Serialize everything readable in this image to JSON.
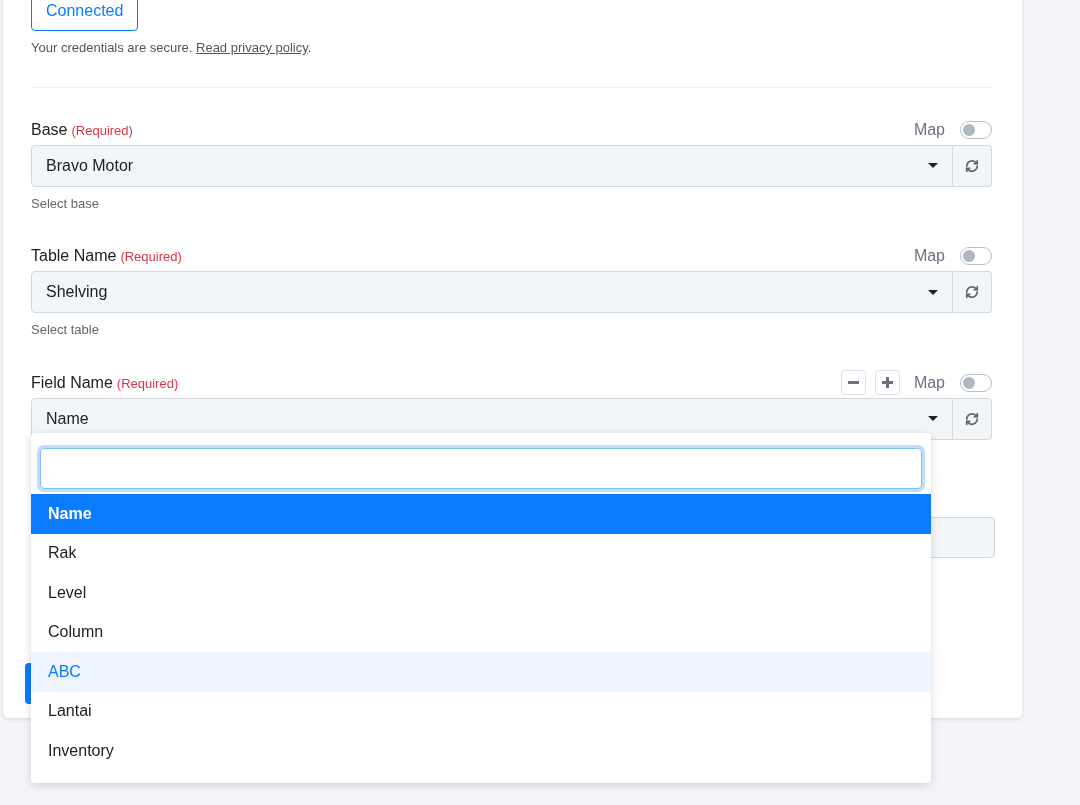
{
  "account": {
    "button": "Connected",
    "note": "Your credentials are secure. ",
    "link": "Read privacy policy",
    "note_end": "."
  },
  "fields": [
    {
      "label": "Base",
      "required": "(Required)",
      "map_label": "Map",
      "map_on": false,
      "value": "Bravo Motor",
      "helper": "Select base",
      "stepper": false
    },
    {
      "label": "Table Name",
      "required": "(Required)",
      "map_label": "Map",
      "map_on": false,
      "value": "Shelving",
      "helper": "Select table",
      "stepper": false
    },
    {
      "label": "Field Name",
      "required": "(Required)",
      "map_label": "Map",
      "map_on": false,
      "value": "Name",
      "stepper": true
    }
  ],
  "dropdown": {
    "options": [
      {
        "label": "Name",
        "selected": true,
        "highlighted": false
      },
      {
        "label": "Rak",
        "selected": false,
        "highlighted": false
      },
      {
        "label": "Level",
        "selected": false,
        "highlighted": false
      },
      {
        "label": "Column",
        "selected": false,
        "highlighted": false
      },
      {
        "label": "ABC",
        "selected": false,
        "highlighted": true
      },
      {
        "label": "Lantai",
        "selected": false,
        "highlighted": false
      },
      {
        "label": "Inventory",
        "selected": false,
        "highlighted": false
      }
    ]
  }
}
